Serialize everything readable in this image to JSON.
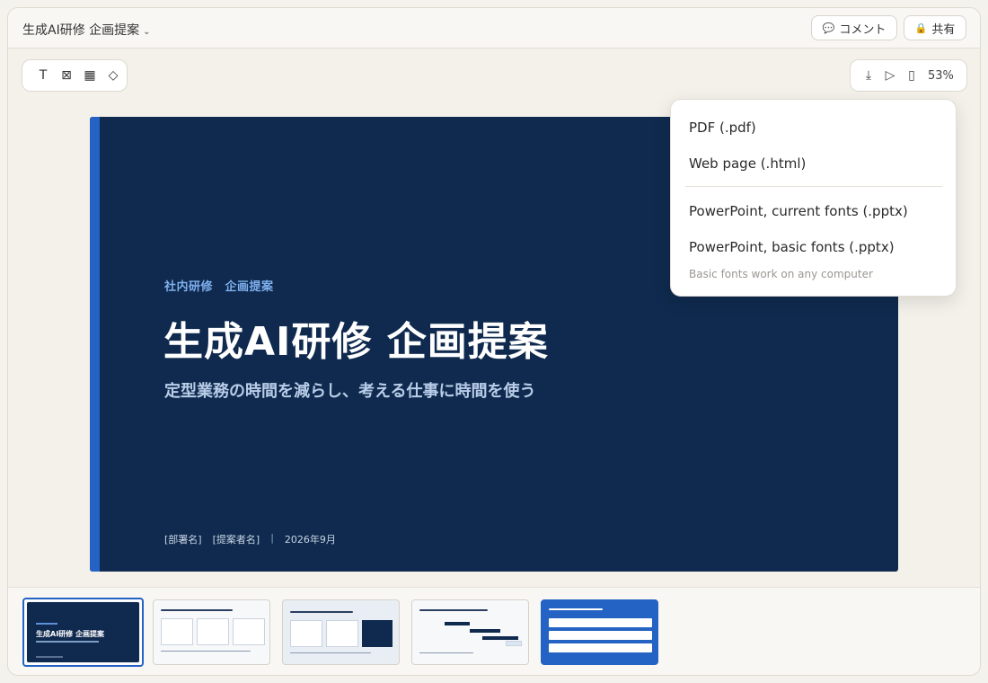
{
  "header": {
    "doc_title": "生成AI研修 企画提案",
    "title_chevron": "⌄",
    "comment_label": "コメント",
    "comment_icon": "💬",
    "share_label": "共有",
    "share_icon": "🔒"
  },
  "toolbar_left": {
    "tools": [
      {
        "name": "text-tool",
        "glyph": "T"
      },
      {
        "name": "image-tool",
        "glyph": "⊠"
      },
      {
        "name": "table-tool",
        "glyph": "▦"
      },
      {
        "name": "shape-tool",
        "glyph": "◇"
      }
    ]
  },
  "toolbar_right": {
    "download_glyph": "⤓",
    "present_glyph": "▷",
    "device_glyph": "▯",
    "zoom": "53%"
  },
  "slide": {
    "eyebrow": "社内研修　企画提案",
    "title": "生成AI研修 企画提案",
    "subtitle": "定型業務の時間を減らし、考える仕事に時間を使う",
    "dept": "[部署名]",
    "proposer": "[提案者名]",
    "separator": "|",
    "date": "2026年9月"
  },
  "export_menu": {
    "items": [
      "PDF (.pdf)",
      "Web page (.html)",
      "PowerPoint, current fonts (.pptx)",
      "PowerPoint, basic fonts (.pptx)"
    ],
    "note": "Basic fonts work on any computer"
  },
  "filmstrip": {
    "selected_index": 0,
    "count": 5
  },
  "colors": {
    "slide_bg": "#0f2a4e",
    "accent_blue": "#2463c4",
    "eyebrow": "#7fb0ef",
    "app_bg": "#f3f1ea"
  }
}
